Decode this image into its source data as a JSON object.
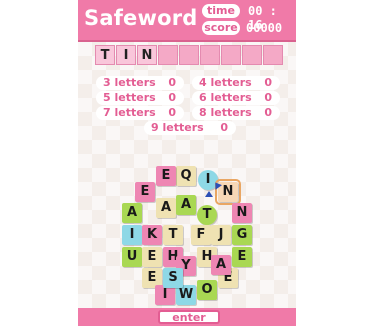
{
  "game": {
    "title": "Safeword",
    "time_label": "time",
    "time_value": "00 : 16",
    "score_label": "score",
    "score_value": "00000"
  },
  "current_word": {
    "letters": [
      "T",
      "I",
      "N",
      "",
      "",
      "",
      "",
      "",
      ""
    ]
  },
  "word_counts": [
    {
      "label": "3 letters",
      "count": "0"
    },
    {
      "label": "4 letters",
      "count": "0"
    },
    {
      "label": "5 letters",
      "count": "0"
    },
    {
      "label": "6 letters",
      "count": "0"
    },
    {
      "label": "7 letters",
      "count": "0"
    },
    {
      "label": "8 letters",
      "count": "0"
    },
    {
      "label": "9 letters",
      "count": "0"
    }
  ],
  "board": {
    "tiles": [
      {
        "letter": "Q",
        "color": "#efe2b2"
      },
      {
        "letter": "E",
        "color": "#ee86b3"
      },
      {
        "letter": "I",
        "color": "#8ed8e6"
      },
      {
        "letter": "N",
        "color": "#f7d8b6"
      },
      {
        "letter": "N",
        "color": "#8ed8e6"
      },
      {
        "letter": "A",
        "color": "#a9d853"
      },
      {
        "letter": "A",
        "color": "#efe2b2"
      },
      {
        "letter": "A",
        "color": "#a9d853"
      },
      {
        "letter": "T",
        "color": "#a9d853"
      },
      {
        "letter": "N",
        "color": "#ee86b3"
      },
      {
        "letter": "I",
        "color": "#8ed8e6"
      },
      {
        "letter": "K",
        "color": "#ee86b3"
      },
      {
        "letter": "T",
        "color": "#efe2b2"
      },
      {
        "letter": "F",
        "color": "#efe2b2"
      },
      {
        "letter": "J",
        "color": "#efe2b2"
      },
      {
        "letter": "G",
        "color": "#a9d853"
      },
      {
        "letter": "U",
        "color": "#a9d853"
      },
      {
        "letter": "E",
        "color": "#efe2b2"
      },
      {
        "letter": "H",
        "color": "#ee86b3"
      },
      {
        "letter": "Y",
        "color": "#ee86b3"
      },
      {
        "letter": "D",
        "color": "#efe2b2"
      },
      {
        "letter": "E",
        "color": "#a9d853"
      },
      {
        "letter": "A",
        "color": "#ee86b3"
      },
      {
        "letter": "I",
        "color": "#ee86b3"
      },
      {
        "letter": "S",
        "color": "#8ed8e6"
      },
      {
        "letter": "E",
        "color": "#efe2b2"
      },
      {
        "letter": "O",
        "color": "#a9d853"
      },
      {
        "letter": "W",
        "color": "#8ed8e6"
      },
      {
        "letter": "I",
        "color": "#8ed8e6"
      }
    ],
    "selected": [
      "T",
      "I",
      "N"
    ]
  },
  "enter_label": "enter"
}
